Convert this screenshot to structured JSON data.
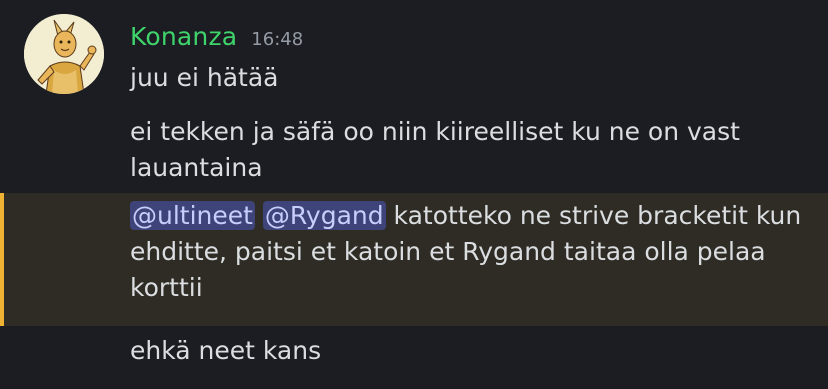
{
  "message": {
    "username": "Konanza",
    "timestamp": "16:48",
    "lines": [
      "juu ei hätää",
      "ei tekken ja säfä oo niin kiireelliset ku ne on vast lauantaina"
    ],
    "mention_message": {
      "mentions": [
        "@ultineet",
        "@Rygand"
      ],
      "text": " katotteko ne strive bracketit kun ehditte, paitsi et katoin et Rygand taitaa olla pelaa korttii"
    },
    "last_line": "ehkä neet kans"
  },
  "colors": {
    "background": "#1c1d22",
    "username": "#3fd36b",
    "timestamp": "#949ba4",
    "text": "#dbdee1",
    "mention_bg": "#3e4379",
    "mention_text": "#c9cdfb",
    "highlight_bg": "#2f2c25",
    "highlight_bar": "#f0b232"
  },
  "icons": {
    "avatar": "user-avatar-illustration"
  }
}
